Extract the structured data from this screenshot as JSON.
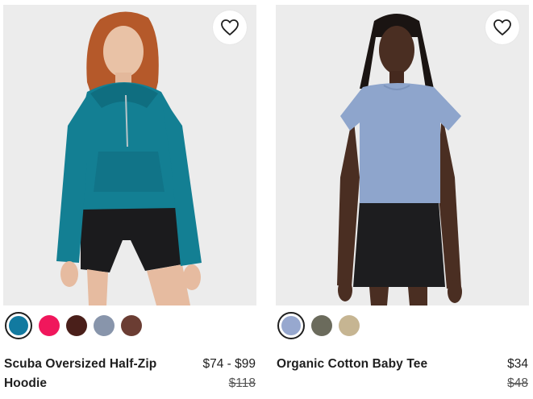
{
  "products": [
    {
      "name": "Scuba Oversized Half-Zip Hoodie",
      "price": "$74 - $99",
      "original_price": "$118",
      "wishlist_icon": "heart-outline-icon",
      "image": "woman wearing teal half-zip hoodie and black bike shorts",
      "swatches": [
        {
          "color": "#127aa0",
          "selected": true
        },
        {
          "color": "#f0175c",
          "selected": false
        },
        {
          "color": "#4a1f1a",
          "selected": false
        },
        {
          "color": "#8895ab",
          "selected": false
        },
        {
          "color": "#6b3d33",
          "selected": false
        }
      ]
    },
    {
      "name": "Organic Cotton Baby Tee",
      "price": "$34",
      "original_price": "$48",
      "wishlist_icon": "heart-outline-icon",
      "image": "woman wearing light blue fitted tee and black skirt",
      "swatches": [
        {
          "color": "#97a8cf",
          "selected": true
        },
        {
          "color": "#6b6b5c",
          "selected": false
        },
        {
          "color": "#c6b592",
          "selected": false
        }
      ]
    }
  ]
}
